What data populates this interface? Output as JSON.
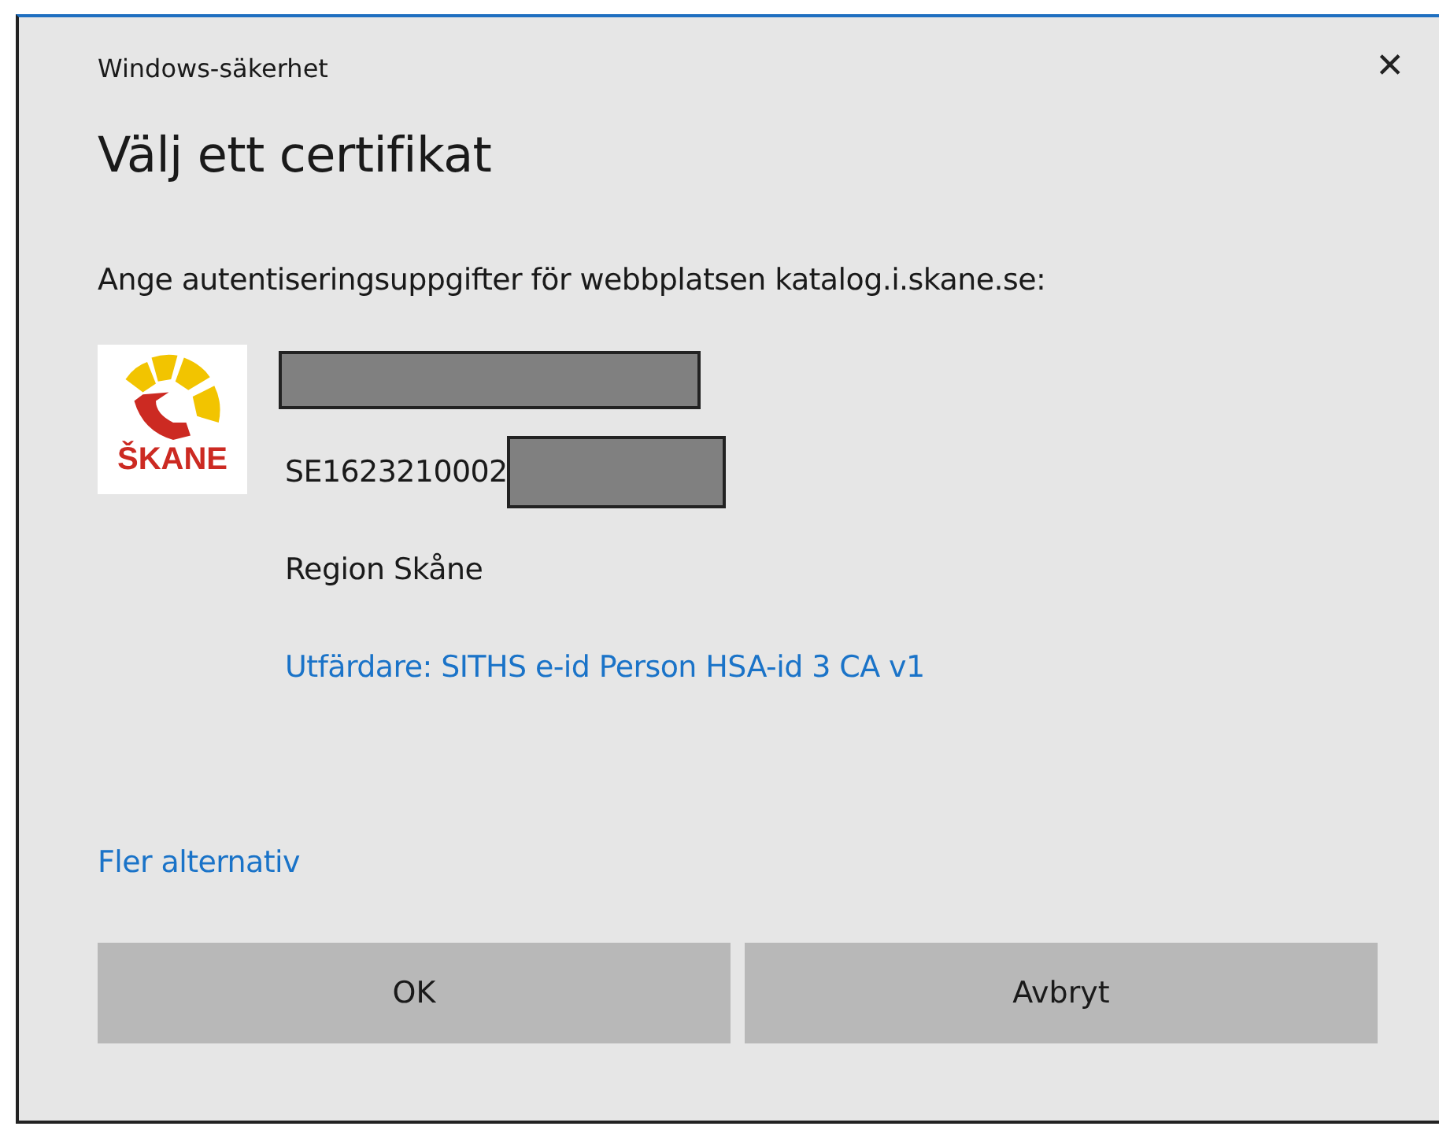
{
  "window": {
    "title": "Windows-säkerhet",
    "close": "✕"
  },
  "heading": "Välj ett certifikat",
  "prompt": "Ange autentiseringsuppgifter för webbplatsen katalog.i.skane.se:",
  "certificate": {
    "logo_text": "ŠKANE",
    "lines": [
      {
        "kind": "redacted"
      },
      {
        "kind": "text",
        "text": "SE1623210002",
        "redacted": true
      },
      {
        "kind": "text",
        "text": "Region Skåne"
      },
      {
        "kind": "link",
        "text": "Utfärdare: SITHS e-id Person HSA-id 3 CA v1"
      }
    ]
  },
  "more_options": "Fler alternativ",
  "buttons": [
    "OK",
    "Avbryt"
  ]
}
